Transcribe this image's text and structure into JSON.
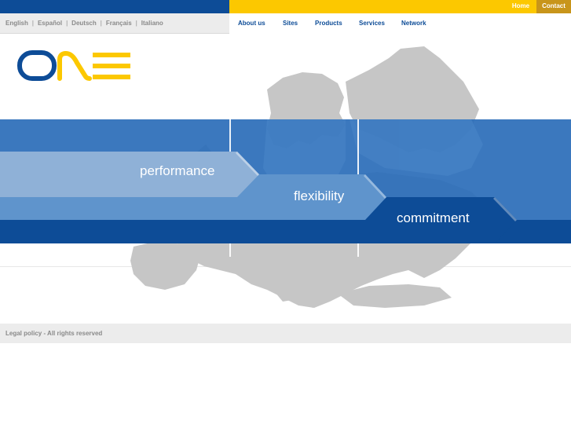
{
  "header": {
    "home_label": "Home",
    "contact_label": "Contact"
  },
  "languages": [
    {
      "label": "English"
    },
    {
      "label": "Español"
    },
    {
      "label": "Deutsch"
    },
    {
      "label": "Français"
    },
    {
      "label": "Italiano"
    }
  ],
  "language_separator": "|",
  "nav": {
    "about": "About us",
    "sites": "Sites",
    "products": "Products",
    "services": "Services",
    "network": "Network"
  },
  "logo": {
    "text": "ONE"
  },
  "hero": {
    "arrows": [
      {
        "label": "performance"
      },
      {
        "label": "flexibility"
      },
      {
        "label": "commitment"
      }
    ]
  },
  "footer": {
    "legal": "Legal policy - All rights reserved"
  },
  "colors": {
    "brand_blue": "#0d4c97",
    "brand_yellow": "#fcc800",
    "contact_gold": "#c8951a",
    "band_blue": "#2a6db8",
    "arrow_light": "#8fb1d7",
    "arrow_mid": "#5f94cc",
    "arrow_dark": "#0d4c97",
    "map_grey": "#c6c6c6",
    "footer_grey": "#ececec",
    "link_grey": "#8a8a8a"
  }
}
